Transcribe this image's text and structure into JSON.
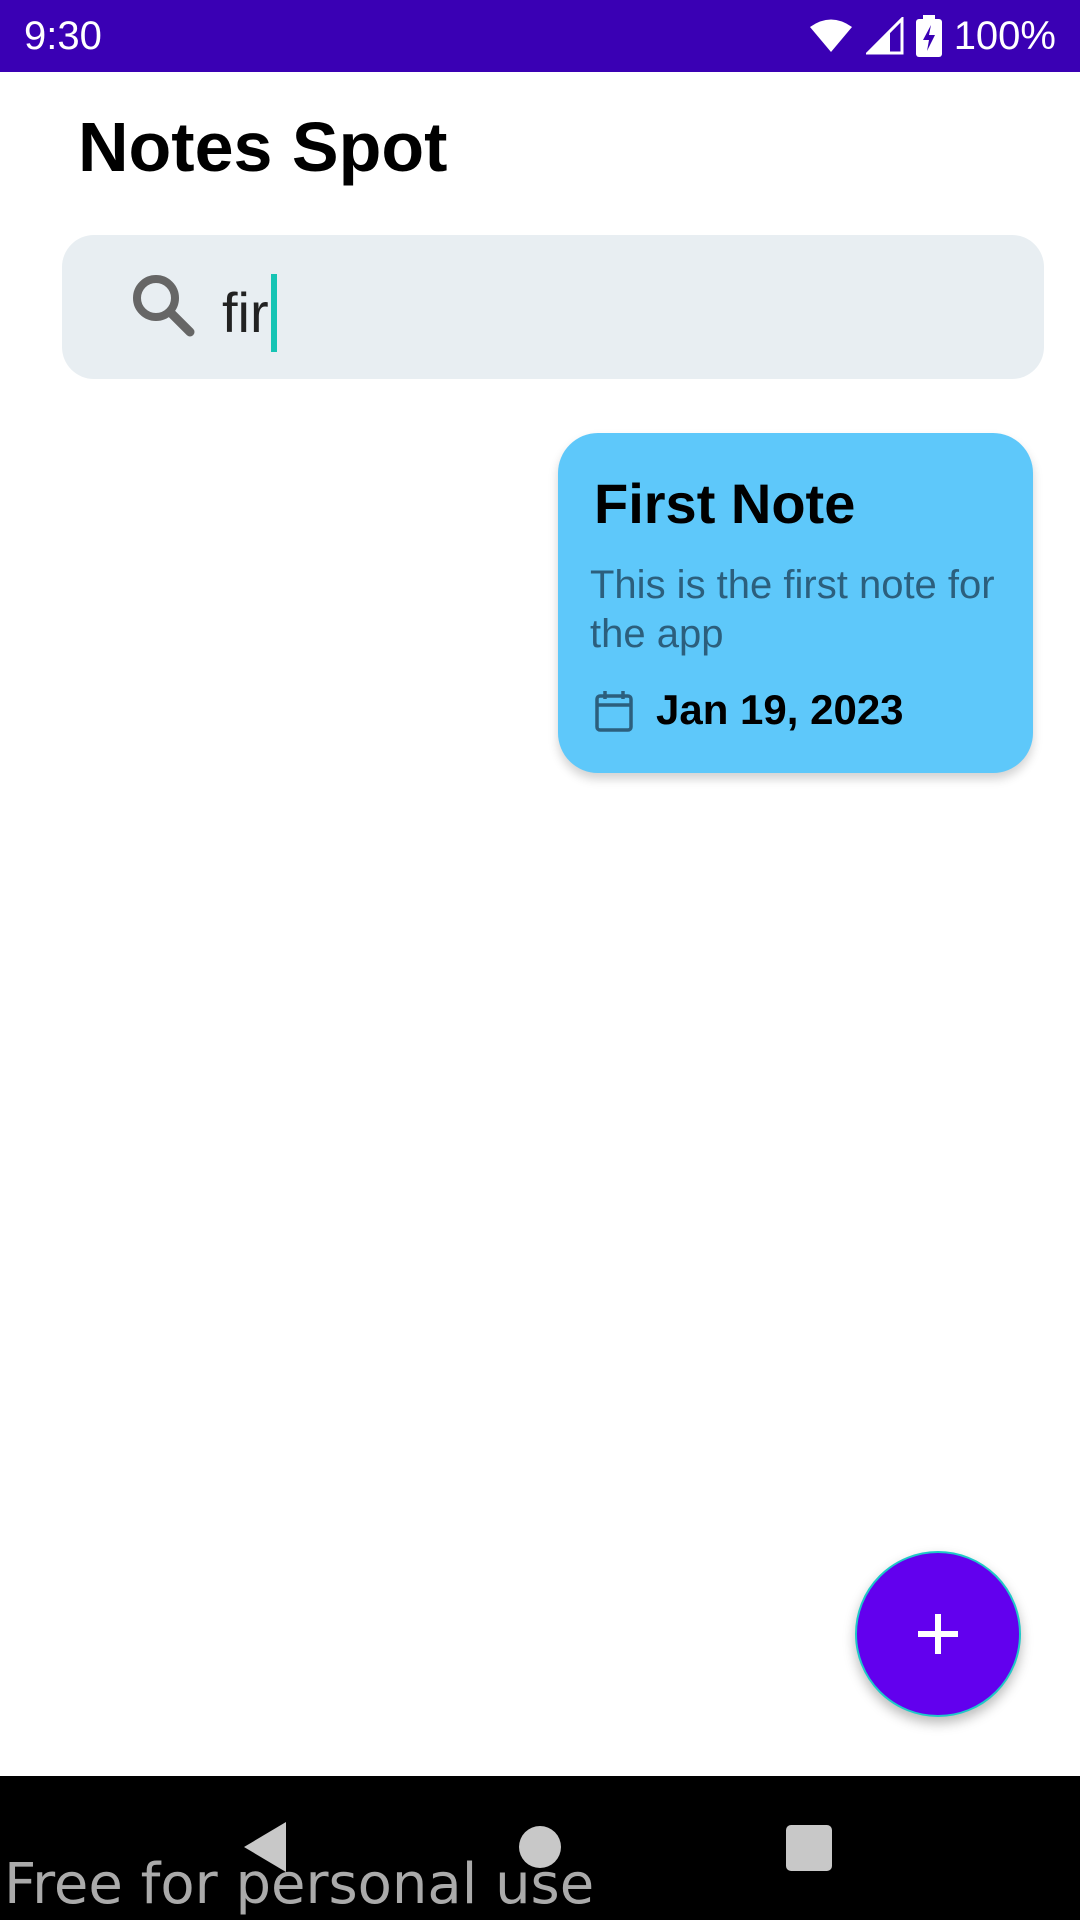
{
  "status_bar": {
    "time": "9:30",
    "battery_text": "100%",
    "icons": [
      "wifi-icon",
      "signal-icon",
      "battery-charging-icon"
    ]
  },
  "app": {
    "title": "Notes Spot",
    "accent_color": "#6200ee"
  },
  "search": {
    "icon": "search-icon",
    "value": "fir"
  },
  "notes": [
    {
      "title": "First Note",
      "body": "This is the first note for the app",
      "date": "Jan 19, 2023",
      "color": "#5ec8fa"
    }
  ],
  "fab": {
    "icon": "plus-icon"
  },
  "nav_bar": {
    "buttons": [
      "back-icon",
      "home-icon",
      "recents-icon"
    ]
  },
  "watermark": "Free for personal use"
}
